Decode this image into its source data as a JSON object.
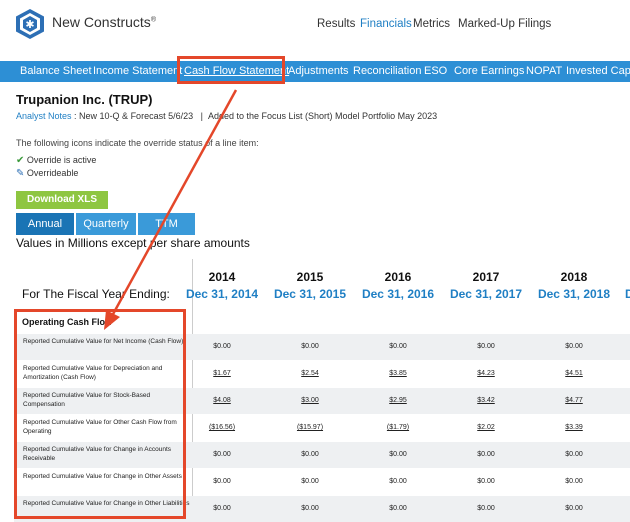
{
  "header": {
    "brand": "New Constructs",
    "brand_mark": "®",
    "nav": [
      "Results",
      "Financials",
      "Metrics",
      "Marked-Up Filings"
    ],
    "active_nav": "Financials"
  },
  "subnav": {
    "items": [
      "Balance Sheet",
      "Income Statement",
      "Cash Flow Statement",
      "Adjustments",
      "Reconciliation",
      "ESO",
      "Core Earnings",
      "NOPAT",
      "Invested Capit"
    ],
    "active": "Cash Flow Statement"
  },
  "company": {
    "title": "Trupanion Inc. (TRUP)",
    "analyst_notes_label": "Analyst Notes",
    "analyst_notes_sep": " : ",
    "note1": "New 10-Q & Forecast 5/6/23",
    "note_divider": "|",
    "note2": "Added to the Focus List (Short) Model Portfolio May 2023"
  },
  "legend": {
    "intro": "The following icons indicate the override status of a line item:",
    "active": "Override is active",
    "overrideable": "Overrideable"
  },
  "download_label": "Download XLS",
  "tabs": [
    "Annual",
    "Quarterly",
    "TTM"
  ],
  "values_note": "Values in Millions except per share amounts",
  "table": {
    "fiscal_label": "For The Fiscal Year Ending:",
    "years": [
      "2014",
      "2015",
      "2016",
      "2017",
      "2018"
    ],
    "dates": [
      "Dec 31, 2014",
      "Dec 31, 2015",
      "Dec 31, 2016",
      "Dec 31, 2017",
      "Dec 31, 2018"
    ],
    "next_date_partial": "D",
    "section": "Operating Cash Flow",
    "rows": [
      {
        "label": "Reported Cumulative Value for Net Income (Cash Flow)",
        "values": [
          "$0.00",
          "$0.00",
          "$0.00",
          "$0.00",
          "$0.00"
        ],
        "underline": false
      },
      {
        "label": "Reported Cumulative Value for Depreciation and Amortization (Cash Flow)",
        "values": [
          "$1.67",
          "$2.54",
          "$3.85",
          "$4.23",
          "$4.51"
        ],
        "underline": true
      },
      {
        "label": "Reported Cumulative Value for Stock-Based Compensation",
        "values": [
          "$4.08",
          "$3.00",
          "$2.95",
          "$3.42",
          "$4.77"
        ],
        "underline": true
      },
      {
        "label": "Reported Cumulative Value for Other Cash Flow from Operating",
        "values": [
          "($16.56)",
          "($15.97)",
          "($1.79)",
          "$2.02",
          "$3.39"
        ],
        "underline": true
      },
      {
        "label": "Reported Cumulative Value for Change in Accounts Receivable",
        "values": [
          "$0.00",
          "$0.00",
          "$0.00",
          "$0.00",
          "$0.00"
        ],
        "underline": false
      },
      {
        "label": "Reported Cumulative Value for Change in Other Assets",
        "values": [
          "$0.00",
          "$0.00",
          "$0.00",
          "$0.00",
          "$0.00"
        ],
        "underline": false
      },
      {
        "label": "Reported Cumulative Value for Change in Other Liabilities",
        "values": [
          "$0.00",
          "$0.00",
          "$0.00",
          "$0.00",
          "$0.00"
        ],
        "underline": false
      }
    ]
  },
  "colors": {
    "accent": "#2d8fd5",
    "highlight": "#e4472a",
    "download": "#8ec641"
  }
}
